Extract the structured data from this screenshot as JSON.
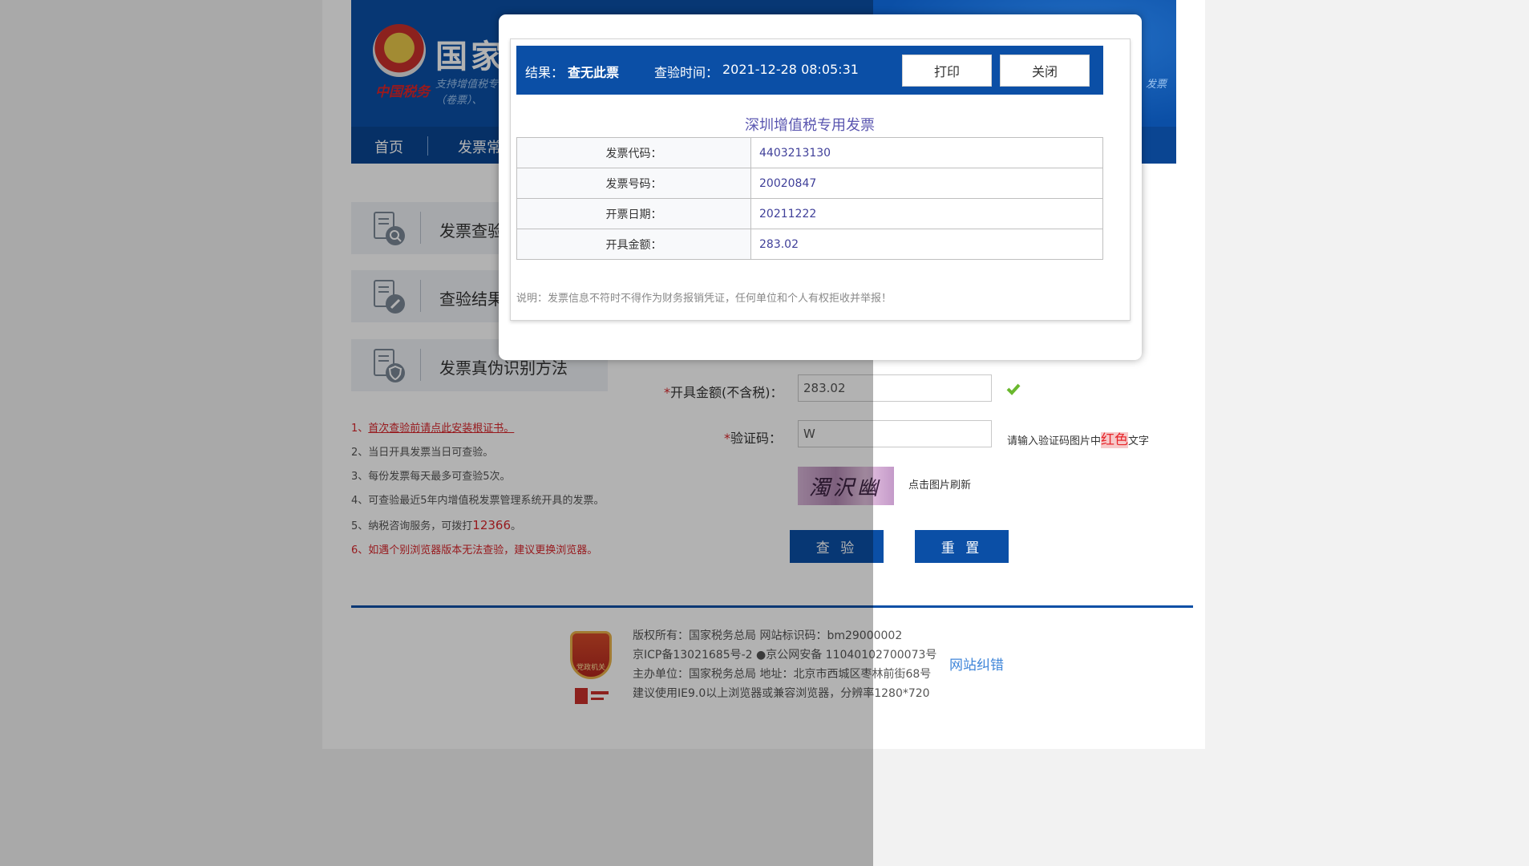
{
  "header": {
    "title": "国家",
    "emblem_text": "中国税务",
    "subtitle_line1": "支持增值税专",
    "subtitle_line2": "（卷票）、  ",
    "subtitle_right": "发票"
  },
  "nav": {
    "items": [
      "首页",
      "发票常"
    ]
  },
  "menu": [
    {
      "label": "发票查验",
      "icon": "document-search-icon"
    },
    {
      "label": "查验结果",
      "icon": "document-edit-icon"
    },
    {
      "label": "发票真伪识别方法",
      "icon": "document-shield-icon"
    }
  ],
  "notes": [
    {
      "num": "1、",
      "text": "首次查验前请点此安装根证书。"
    },
    {
      "num": "2、",
      "text": "当日开具发票当日可查验。"
    },
    {
      "num": "3、",
      "text": "每份发票每天最多可查验5次。"
    },
    {
      "num": "4、",
      "text": "可查验最近5年内增值税发票管理系统开具的发票。"
    },
    {
      "num": "5、",
      "text_pre": "纳税咨询服务，可拨打",
      "text_highlight": "12366",
      "text_post": "。"
    },
    {
      "num": "6、",
      "text": "如遇个别浏览器版本无法查验，建议更换浏览器。"
    }
  ],
  "form": {
    "amount_label": "开具金额(不含税)：",
    "amount_value": "283.02",
    "captcha_label": "验证码：",
    "captcha_value": "W",
    "captcha_hint_pre": "请输入验证码图片中",
    "captcha_hint_highlight": "红色",
    "captcha_hint_post": "文字",
    "captcha_image_text": "濁沢幽島",
    "captcha_refresh": "点击图片刷新",
    "check_button": "查 验",
    "reset_button": "重 置"
  },
  "footer": {
    "badge_text": "党政机关",
    "line1": "版权所有：国家税务总局 网站标识码：bm29000002",
    "line2": "京ICP备13021685号-2 ●京公网安备 11040102700073号",
    "line3": "主办单位：国家税务总局 地址：北京市西城区枣林前街68号",
    "line4": "建议使用IE9.0以上浏览器或兼容浏览器，分辨率1280*720",
    "report_link": "网站纠错"
  },
  "modal": {
    "result_label": "结果：",
    "result_value": "查无此票",
    "time_label": "查验时间：",
    "time_value": "2021-12-28 08:05:31",
    "print_button": "打印",
    "close_button": "关闭",
    "invoice_title": "深圳增值税专用发票",
    "rows": [
      {
        "key": "发票代码：",
        "value": "4403213130"
      },
      {
        "key": "发票号码：",
        "value": "20020847"
      },
      {
        "key": "开票日期：",
        "value": "20211222"
      },
      {
        "key": "开具金额：",
        "value": "283.02"
      }
    ],
    "note": "说明：发票信息不符时不得作为财务报销凭证，任何单位和个人有权拒收并举报！"
  },
  "colors": {
    "brand_blue": "#0b4fa6",
    "accent_red": "#d9262b",
    "link_blue": "#3f86d9"
  }
}
